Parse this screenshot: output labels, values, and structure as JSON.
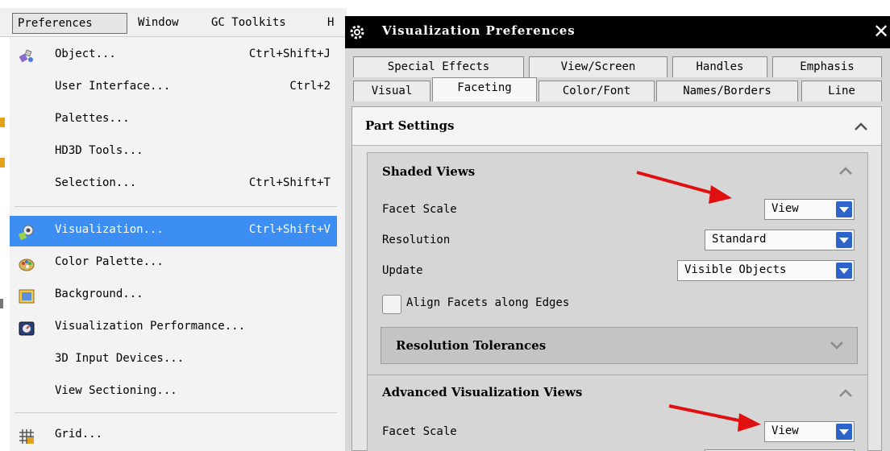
{
  "menubar": {
    "items": [
      "Preferences",
      "Window",
      "GC Toolkits",
      "H"
    ]
  },
  "menu": {
    "items": [
      {
        "label": "Object...",
        "shortcut": "Ctrl+Shift+J",
        "icon": "object-icon"
      },
      {
        "label": "User Interface...",
        "shortcut": "Ctrl+2",
        "icon": ""
      },
      {
        "label": "Palettes...",
        "shortcut": "",
        "icon": ""
      },
      {
        "label": "HD3D Tools...",
        "shortcut": "",
        "icon": ""
      },
      {
        "label": "Selection...",
        "shortcut": "Ctrl+Shift+T",
        "icon": ""
      },
      {
        "label": "Visualization...",
        "shortcut": "Ctrl+Shift+V",
        "icon": "visualization-icon",
        "highlighted": true
      },
      {
        "label": "Color Palette...",
        "shortcut": "",
        "icon": "color-palette-icon"
      },
      {
        "label": "Background...",
        "shortcut": "",
        "icon": "background-icon"
      },
      {
        "label": "Visualization Performance...",
        "shortcut": "",
        "icon": "performance-icon"
      },
      {
        "label": "3D Input Devices...",
        "shortcut": "",
        "icon": ""
      },
      {
        "label": "View Sectioning...",
        "shortcut": "",
        "icon": ""
      },
      {
        "label": "Grid...",
        "shortcut": "",
        "icon": "grid-icon"
      }
    ]
  },
  "dialog": {
    "title": "Visualization Preferences",
    "tabs_row1": [
      "Special Effects",
      "View/Screen",
      "Handles",
      "Emphasis"
    ],
    "tabs_row2": [
      "Visual",
      "Faceting",
      "Color/Font",
      "Names/Borders",
      "Line"
    ],
    "active_tab": "Faceting",
    "part_settings": "Part Settings",
    "shaded_views": {
      "header": "Shaded Views",
      "facet_scale_label": "Facet Scale",
      "facet_scale_value": "View",
      "resolution_label": "Resolution",
      "resolution_value": "Standard",
      "update_label": "Update",
      "update_value": "Visible Objects",
      "align_label": "Align Facets along Edges",
      "resolution_tolerances": "Resolution Tolerances"
    },
    "advanced_views": {
      "header": "Advanced Visualization Views",
      "facet_scale_label": "Facet Scale",
      "facet_scale_value": "View"
    }
  },
  "colors": {
    "highlight": "#3d8ef2",
    "dropdown_button": "#2e63c9",
    "annotation_arrow": "#e01010",
    "titlebar": "#000000"
  }
}
